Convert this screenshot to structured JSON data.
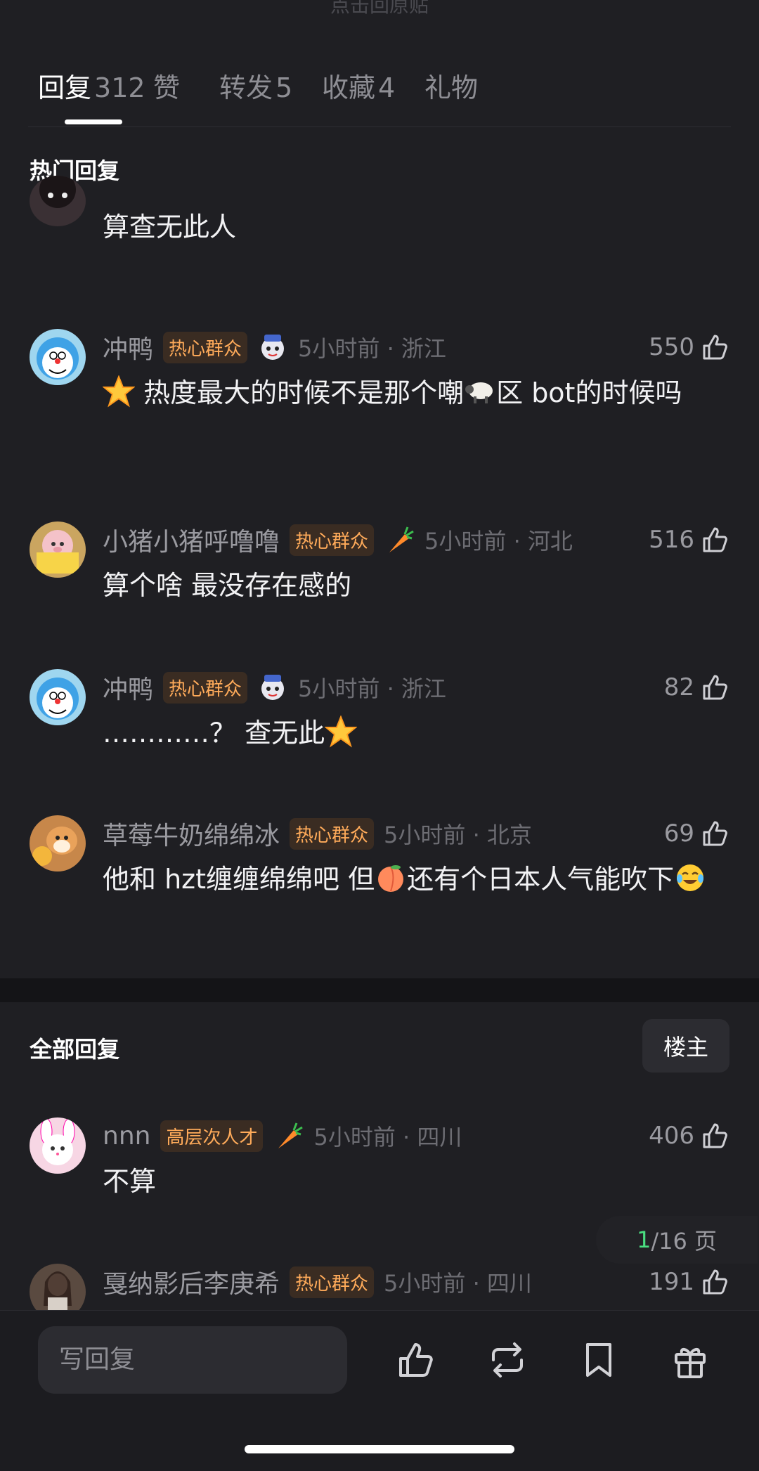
{
  "top_hint": "点击回原贴",
  "tabs": [
    {
      "label": "回复",
      "count": "312"
    },
    {
      "label": "赞",
      "count": ""
    },
    {
      "label": "转发",
      "count": "5"
    },
    {
      "label": "收藏",
      "count": "4"
    },
    {
      "label": "礼物",
      "count": ""
    }
  ],
  "hot_section_title": "热门回复",
  "partial_comment": {
    "body": "算查无此人"
  },
  "hot_comments": [
    {
      "user": "冲鸭",
      "badge": "热心群众",
      "time": "5小时前 · 浙江",
      "likes": "550",
      "body_parts": [
        "热度最大的时候不是那个嘲",
        "区 bot的时候吗"
      ]
    },
    {
      "user": "小猪小猪呼噜噜",
      "badge": "热心群众",
      "time": "5小时前 · 河北",
      "likes": "516",
      "body": "算个啥 最没存在感的"
    },
    {
      "user": "冲鸭",
      "badge": "热心群众",
      "time": "5小时前 · 浙江",
      "likes": "82",
      "body": "…………？ 查无此"
    },
    {
      "user": "草莓牛奶绵绵冰",
      "badge": "热心群众",
      "time": "5小时前 · 北京",
      "likes": "69",
      "body_parts": [
        "他和 hzt缠缠绵绵吧 但",
        "还有个日本人气能吹下"
      ]
    }
  ],
  "all_section_title": "全部回复",
  "louzhu_button": "楼主",
  "all_comments": [
    {
      "user": "nnn",
      "badge": "高层次人才",
      "time": "5小时前 · 四川",
      "likes": "406",
      "body": "不算"
    },
    {
      "user": "戛纳影后李庚希",
      "badge": "热心群众",
      "time": "5小时前 · 四川",
      "likes": "191",
      "body": ""
    }
  ],
  "pager": {
    "current": "1",
    "total": "/16 页"
  },
  "bottom_bar": {
    "reply_placeholder": "写回复"
  },
  "colors": {
    "background": "#1f1f23",
    "badge_text": "#ffab5a",
    "badge_bg": "#3a2c22",
    "pager_current": "#4ade80"
  }
}
